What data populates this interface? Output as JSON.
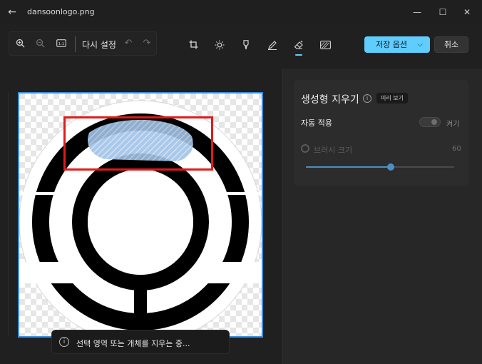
{
  "window": {
    "title": "dansoonlogo.png",
    "back_icon": "arrow-left-icon",
    "controls": [
      "minimize-icon",
      "maximize-icon",
      "close-icon"
    ]
  },
  "toolbar": {
    "reset_label": "다시 설정",
    "save_label": "저장 옵션",
    "cancel_label": "취소",
    "accent_color": "#60cdff",
    "tools": [
      "crop-icon",
      "brightness-icon",
      "markup-icon",
      "draw-icon",
      "erase-icon",
      "background-icon"
    ],
    "active_tool": "erase-icon"
  },
  "toast": {
    "message": "선택 영역 또는 개체를 지우는 중..."
  },
  "panel": {
    "title": "생성형 지우기",
    "preview_badge": "미리 보기",
    "auto_apply_label": "자동 적용",
    "auto_apply_state": "켜기",
    "brush_size_label": "브러시 크기",
    "brush_size_value": "60",
    "brush_size_fraction": 0.57
  },
  "colors": {
    "selection_rect": "#e01b1b",
    "image_border": "#3b8ddb",
    "slider": "#4a90c2"
  }
}
